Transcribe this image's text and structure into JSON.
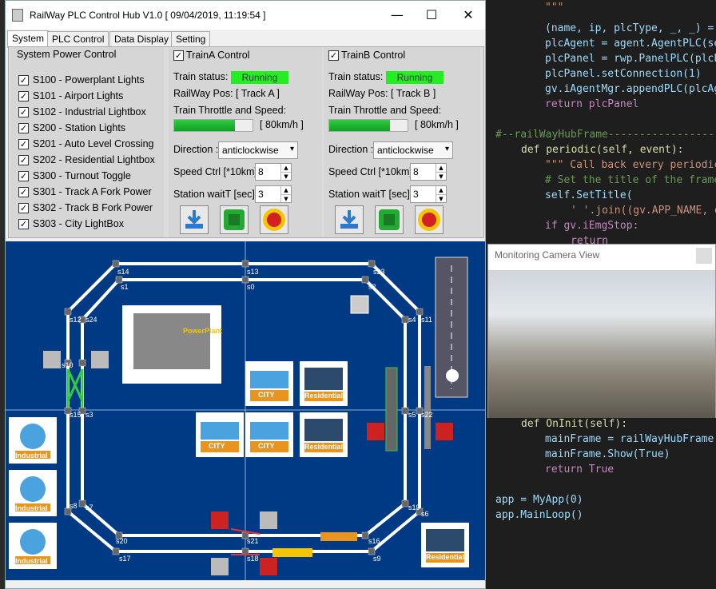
{
  "window": {
    "title": "RailWay PLC Control Hub V1.0 [ 09/04/2019, 11:19:54 ]",
    "minimize": "—",
    "maximize": "☐",
    "close": "✕"
  },
  "tabs": [
    {
      "label": "System"
    },
    {
      "label": "PLC Control"
    },
    {
      "label": "Data Display"
    },
    {
      "label": "Setting"
    }
  ],
  "power": {
    "title": "System Power Control",
    "items": [
      {
        "label": "S100 - Powerplant Lights",
        "checked": true
      },
      {
        "label": "S101 - Airport Lights",
        "checked": true
      },
      {
        "label": "S102 - Industrial Lightbox",
        "checked": true
      },
      {
        "label": "S200 - Station Lights",
        "checked": true
      },
      {
        "label": "S201 - Auto Level Crossing",
        "checked": true
      },
      {
        "label": "S202 - Residential Lightbox",
        "checked": true
      },
      {
        "label": "S300 - Turnout Toggle",
        "checked": true
      },
      {
        "label": "S301 - Track A Fork Power",
        "checked": true
      },
      {
        "label": "S302 - Track B Fork Power",
        "checked": true
      },
      {
        "label": "S303 - City LightBox",
        "checked": true
      }
    ]
  },
  "trainA": {
    "title": "TrainA Control",
    "status_label": "Train status:",
    "status": "Running",
    "pos": "RailWay Pos: [ Track A ]",
    "throttle_label": "Train Throttle and Speed:",
    "speed": "[ 80km/h ]",
    "throttle": 0.78,
    "dir_label": "Direction :",
    "direction": "anticlockwise",
    "speed_ctrl_label": "Speed Ctrl [*10km]",
    "speed_ctrl": "8",
    "wait_label": "Station waitT [sec]:",
    "wait": "3"
  },
  "trainB": {
    "title": "TrainB Control",
    "status_label": "Train status:",
    "status": "Running",
    "pos": "RailWay Pos: [ Track B ]",
    "throttle_label": "Train Throttle and Speed:",
    "speed": "[ 80km/h ]",
    "throttle": 0.78,
    "dir_label": "Direction :",
    "direction": "anticlockwise",
    "speed_ctrl_label": "Speed Ctrl [*10km]",
    "speed_ctrl": "8",
    "wait_label": "Station waitT [sec]:",
    "wait": "3"
  },
  "map": {
    "sensors": [
      "s14",
      "s13",
      "s23",
      "s1",
      "s0",
      "s2",
      "s12",
      "s24",
      "s11",
      "s4",
      "s15",
      "s3",
      "s22",
      "s5",
      "s8",
      "s7",
      "s6",
      "s19",
      "s20",
      "s21",
      "s16",
      "s17",
      "s18",
      "s9",
      "s10"
    ],
    "buildings": {
      "powerplant": "PowerPlant",
      "city": "CITY",
      "residential": "Residential",
      "industrial": "Industrial"
    }
  },
  "camera": {
    "title": "Monitoring Camera View"
  },
  "code": [
    {
      "t": "\"\"\"",
      "c": "s"
    },
    {
      "t": "(name, ip, plcType, _, _) = ",
      "c": "v"
    },
    {
      "t": "plcAgent = agent.AgentPLC(se",
      "c": "v"
    },
    {
      "t": "plcPanel = rwp.PanelPLC(plcE",
      "c": "v"
    },
    {
      "t": "plcPanel.setConnection(1)",
      "c": "v"
    },
    {
      "t": "gv.iAgentMgr.appendPLC(plcAg",
      "c": "v"
    },
    {
      "t": "return plcPanel",
      "c": "r"
    },
    {
      "t": "",
      "c": "v"
    },
    {
      "t": "#--railWayHubFrame-----------------",
      "c": "c"
    },
    {
      "t": "def periodic(self, event):",
      "c": "f"
    },
    {
      "t": "\"\"\" Call back every periodic",
      "c": "s"
    },
    {
      "t": "# Set the title of the frame",
      "c": "c"
    },
    {
      "t": "self.SetTitle(",
      "c": "v"
    },
    {
      "t": "' '.join((gv.APP_NAME, d",
      "c": "s"
    },
    {
      "t": "if gv.iEmgStop:",
      "c": "r"
    },
    {
      "t": "return",
      "c": "r"
    },
    {
      "t": "def OnInit(self):",
      "c": "f"
    },
    {
      "t": "mainFrame = railWayHubFrame(",
      "c": "v"
    },
    {
      "t": "mainFrame.Show(True)",
      "c": "v"
    },
    {
      "t": "return True",
      "c": "r"
    },
    {
      "t": "",
      "c": "v"
    },
    {
      "t": "app = MyApp(0)",
      "c": "v"
    },
    {
      "t": "app.MainLoop()",
      "c": "v"
    }
  ]
}
